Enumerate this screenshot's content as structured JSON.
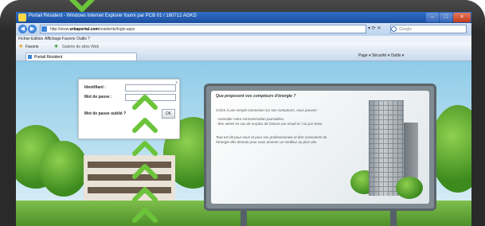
{
  "browser": {
    "window_title": "Portail Résident - Windows Internet Explorer fourni par PCB 01 / 180712 AGKD",
    "address_prefix": "http://www.",
    "address_domain": "urbaportal.com",
    "address_path": "/residents/login.aspx",
    "search_placeholder": "Google",
    "menu": [
      "Fichier",
      "Edition",
      "Affichage",
      "Favoris",
      "Outils",
      "?"
    ],
    "favorites_label": "Favoris",
    "favorites_link": "Galerie de sites Web",
    "tab_label": "Portail Résident",
    "command_bar": "Page ▾  Sécurité ▾  Outils ▾"
  },
  "login": {
    "username_label": "Identifiant :",
    "password_label": "Mot de passe :",
    "forgot_label": "Mot de passe oublié ?",
    "ok_label": "OK",
    "close_label": "x"
  },
  "billboard": {
    "title": "Que proposent vos compteurs d'énergie ?",
    "paragraph_1": "Grâce à une simple connexion sur vos compteurs, vous pouvez :",
    "paragraph_2": "- consulter votre consommation journalière,",
    "paragraph_3": "- être alerté en cas de surplus de facture par email et / ou par texto.",
    "paragraph_4": "Tout est dit pour vous et pour vos professionnels et être conscients de l'énergie dès demain pour vous amener un meilleur au plus vite."
  },
  "colors": {
    "bezel": "#2a2a2a",
    "chevron": "#6cc43a",
    "titlebar": "#1c4e9e",
    "sky": "#8fcbe8"
  }
}
